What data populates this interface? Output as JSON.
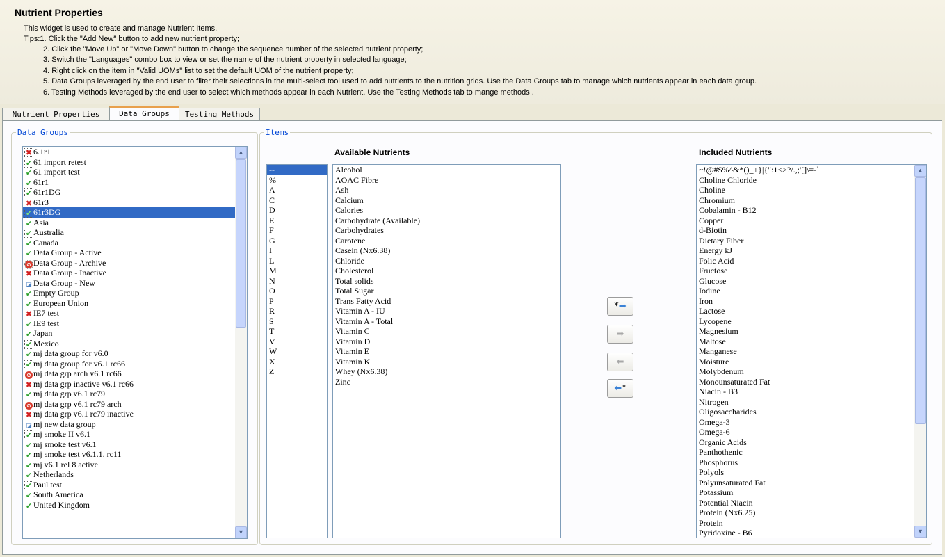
{
  "header": {
    "title": "Nutrient Properties",
    "intro": "This widget is used to create and manage Nutrient Items.",
    "tips": [
      "Tips:1. Click the \"Add New\" button to add new nutrient property;",
      "2. Click the \"Move Up\" or \"Move Down\" button to change the sequence number of the selected nutrient property;",
      "3. Switch the \"Languages\" combo box to view or set the name of the nutrient property in selected language;",
      "4. Right click on the item in \"Valid UOMs\" list to set the default UOM of the nutrient property;",
      "5. Data Groups leveraged by the end user to filter their selections in the multi-select tool used to add nutrients to the nutrition grids. Use the Data Groups tab to manage which nutrients appear in each data group.",
      "6. Testing Methods leveraged by the end user to select which methods appear in each Nutrient. Use the Testing Methods tab to mange methods ."
    ]
  },
  "tabs": [
    "Nutrient Properties",
    "Data Groups",
    "Testing Methods"
  ],
  "active_tab": "Data Groups",
  "data_groups": {
    "legend": "Data Groups",
    "selected": "61r3DG",
    "items": [
      {
        "label": "6.1r1",
        "status": "inactive",
        "boxed": true
      },
      {
        "label": "61 import retest",
        "status": "active",
        "boxed": true
      },
      {
        "label": "61 import test",
        "status": "active",
        "boxed": false
      },
      {
        "label": "61r1",
        "status": "active",
        "boxed": false
      },
      {
        "label": "61r1DG",
        "status": "active",
        "boxed": true
      },
      {
        "label": "61r3",
        "status": "inactive",
        "boxed": false
      },
      {
        "label": "61r3DG",
        "status": "active",
        "boxed": true
      },
      {
        "label": "Asia",
        "status": "active",
        "boxed": false
      },
      {
        "label": "Australia",
        "status": "active",
        "boxed": true
      },
      {
        "label": "Canada",
        "status": "active",
        "boxed": false
      },
      {
        "label": "Data Group - Active",
        "status": "active",
        "boxed": false
      },
      {
        "label": "Data Group - Archive",
        "status": "archive",
        "boxed": true
      },
      {
        "label": "Data Group - Inactive",
        "status": "inactive",
        "boxed": false
      },
      {
        "label": "Data Group - New",
        "status": "new",
        "boxed": false
      },
      {
        "label": "Empty Group",
        "status": "active",
        "boxed": false
      },
      {
        "label": "European Union",
        "status": "active",
        "boxed": false
      },
      {
        "label": "IE7 test",
        "status": "inactive",
        "boxed": false
      },
      {
        "label": "IE9 test",
        "status": "active",
        "boxed": false
      },
      {
        "label": "Japan",
        "status": "active",
        "boxed": false
      },
      {
        "label": "Mexico",
        "status": "active",
        "boxed": true
      },
      {
        "label": "mj data group for v6.0",
        "status": "active",
        "boxed": false
      },
      {
        "label": "mj data group for v6.1 rc66",
        "status": "active",
        "boxed": true
      },
      {
        "label": "mj data grp arch v6.1 rc66",
        "status": "archive",
        "boxed": false
      },
      {
        "label": "mj data grp inactive v6.1 rc66",
        "status": "inactive",
        "boxed": false
      },
      {
        "label": "mj data grp v6.1 rc79",
        "status": "active",
        "boxed": false
      },
      {
        "label": "mj data grp v6.1 rc79 arch",
        "status": "archive",
        "boxed": false
      },
      {
        "label": "mj data grp v6.1 rc79 inactive",
        "status": "inactive",
        "boxed": false
      },
      {
        "label": "mj new data group",
        "status": "new",
        "boxed": false
      },
      {
        "label": "mj smoke II v6.1",
        "status": "active",
        "boxed": true
      },
      {
        "label": "mj smoke test v6.1",
        "status": "active",
        "boxed": false
      },
      {
        "label": "mj smoke test v6.1.1. rc11",
        "status": "active",
        "boxed": false
      },
      {
        "label": "mj v6.1 rel 8 active",
        "status": "active",
        "boxed": false
      },
      {
        "label": "Netherlands",
        "status": "active",
        "boxed": false
      },
      {
        "label": "Paul test",
        "status": "active",
        "boxed": true
      },
      {
        "label": "South America",
        "status": "active",
        "boxed": false
      },
      {
        "label": "United Kingdom",
        "status": "active",
        "boxed": false
      }
    ]
  },
  "items_legend": "Items",
  "letters": {
    "selected": "--",
    "items": [
      "--",
      "%",
      "A",
      "C",
      "D",
      "E",
      "F",
      "G",
      "I",
      "L",
      "M",
      "N",
      "O",
      "P",
      "R",
      "S",
      "T",
      "V",
      "W",
      "X",
      "Z"
    ]
  },
  "available": {
    "title": "Available Nutrients",
    "items": [
      "Alcohol",
      "AOAC Fibre",
      "Ash",
      "Calcium",
      "Calories",
      "Carbohydrate (Available)",
      "Carbohydrates",
      "Carotene",
      "Casein (Nx6.38)",
      "Chloride",
      "Cholesterol",
      "Total solids",
      "Total Sugar",
      "Trans Fatty Acid",
      "Vitamin A - IU",
      "Vitamin A - Total",
      "Vitamin C",
      "Vitamin D",
      "Vitamin E",
      "Vitamin K",
      "Whey (Nx6.38)",
      "Zinc"
    ]
  },
  "move_buttons": [
    {
      "name": "add-all-button",
      "prefix": "*",
      "arrow": "➡",
      "suffix": "",
      "enabled": true
    },
    {
      "name": "add-selected-button",
      "prefix": "",
      "arrow": "➡",
      "suffix": "",
      "enabled": false
    },
    {
      "name": "remove-selected-button",
      "prefix": "",
      "arrow": "⬅",
      "suffix": "",
      "enabled": false
    },
    {
      "name": "remove-all-button",
      "prefix": "",
      "arrow": "⬅",
      "suffix": "*",
      "enabled": true
    }
  ],
  "included": {
    "title": "Included Nutrients",
    "items": [
      "~!@#$%^&*()_+}|{\":1<>?/.,;'[]\\=-`",
      "Choline Chloride",
      "Choline",
      "Chromium",
      "Cobalamin - B12",
      "Copper",
      "d-Biotin",
      "Dietary Fiber",
      "Energy kJ",
      "Folic Acid",
      "Fructose",
      "Glucose",
      "Iodine",
      "Iron",
      "Lactose",
      "Lycopene",
      "Magnesium",
      "Maltose",
      "Manganese",
      "Moisture",
      "Molybdenum",
      "Monounsaturated Fat",
      "Niacin - B3",
      "Nitrogen",
      "Oligosaccharides",
      "Omega-3",
      "Omega-6",
      "Organic Acids",
      "Panthothenic",
      "Phosphorus",
      "Polyols",
      "Polyunsaturated Fat",
      "Potassium",
      "Potential Niacin",
      "Protein (Nx6.25)",
      "Protein",
      "Pyridoxine - B6"
    ]
  },
  "status_icons": {
    "active": "✔",
    "inactive": "✖",
    "archive": "⊘",
    "new": "◪"
  }
}
